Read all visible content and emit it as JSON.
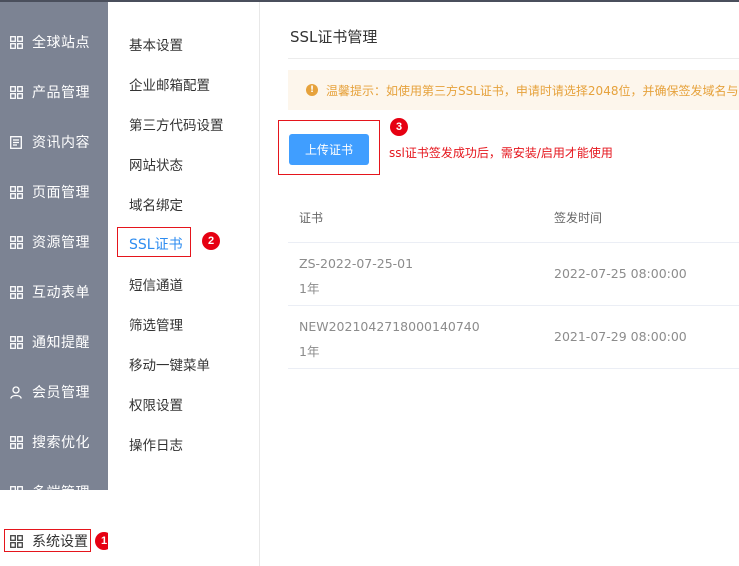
{
  "sidebar": {
    "items": [
      {
        "label": "全球站点",
        "icon": "grid-icon"
      },
      {
        "label": "产品管理",
        "icon": "grid-icon"
      },
      {
        "label": "资讯内容",
        "icon": "document-icon"
      },
      {
        "label": "页面管理",
        "icon": "grid-icon"
      },
      {
        "label": "资源管理",
        "icon": "grid-icon"
      },
      {
        "label": "互动表单",
        "icon": "grid-icon"
      },
      {
        "label": "通知提醒",
        "icon": "grid-icon"
      },
      {
        "label": "会员管理",
        "icon": "user-icon"
      },
      {
        "label": "搜索优化",
        "icon": "grid-icon"
      },
      {
        "label": "多端管理",
        "icon": "grid-icon"
      }
    ],
    "active": {
      "label": "系统设置",
      "icon": "grid-icon"
    }
  },
  "submenu": {
    "items": [
      "基本设置",
      "企业邮箱配置",
      "第三方代码设置",
      "网站状态",
      "域名绑定",
      "SSL证书",
      "短信通道",
      "筛选管理",
      "移动一键菜单",
      "权限设置",
      "操作日志"
    ],
    "active_index": 5
  },
  "badges": [
    "1",
    "2",
    "3"
  ],
  "main": {
    "title": "SSL证书管理",
    "notice": "温馨提示：如使用第三方SSL证书，申请时请选择2048位，并确保签发域名与网站域名一致",
    "upload_label": "上传证书",
    "upload_note": "ssl证书签发成功后，需安装/启用才能使用",
    "table": {
      "headers": [
        "证书",
        "签发时间"
      ],
      "rows": [
        {
          "name": "ZS-2022-07-25-01",
          "duration": "1年",
          "date": "2022-07-25 08:00:00"
        },
        {
          "name": "NEW2021042718000140740",
          "duration": "1年",
          "date": "2021-07-29 08:00:00"
        }
      ]
    }
  },
  "colors": {
    "sidebar_bg": "#7c8393",
    "accent": "#409eff",
    "highlight": "#e5151c",
    "notice_bg": "#fdf6ec",
    "notice_text": "#e6a23c"
  }
}
